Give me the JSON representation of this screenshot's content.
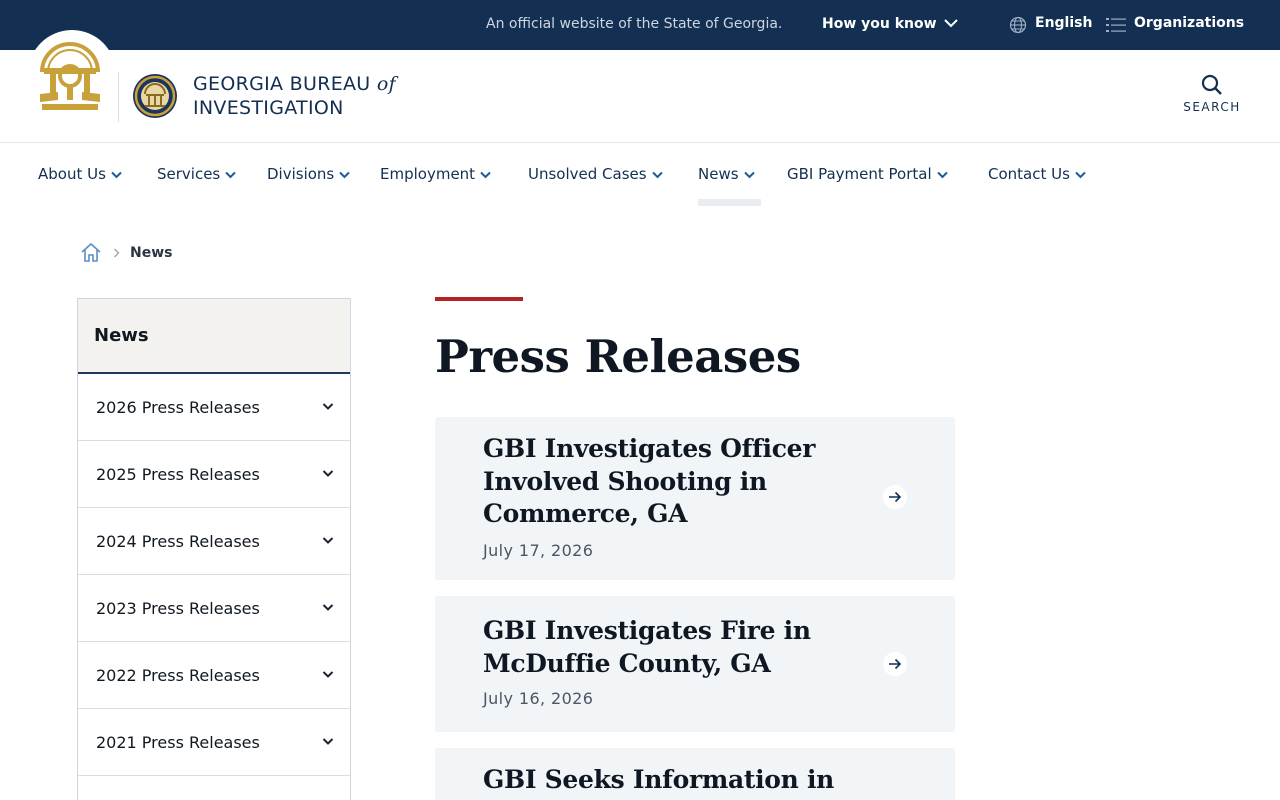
{
  "topbar": {
    "official_text": "An official website of the State of Georgia.",
    "how_you_know": "How you know",
    "language": "English",
    "organizations": "Organizations"
  },
  "header": {
    "org_name_line1": "GEORGIA BUREAU",
    "org_name_of": "of",
    "org_name_line2": "INVESTIGATION",
    "search_label": "SEARCH"
  },
  "nav": {
    "items": [
      {
        "label": "About Us"
      },
      {
        "label": "Services"
      },
      {
        "label": "Divisions"
      },
      {
        "label": "Employment"
      },
      {
        "label": "Unsolved Cases"
      },
      {
        "label": "News",
        "active": true
      },
      {
        "label": "GBI Payment Portal"
      },
      {
        "label": "Contact Us"
      }
    ]
  },
  "breadcrumb": {
    "current": "News"
  },
  "sidebar": {
    "heading": "News",
    "items": [
      {
        "label": "2026 Press Releases"
      },
      {
        "label": "2025 Press Releases"
      },
      {
        "label": "2024 Press Releases"
      },
      {
        "label": "2023 Press Releases"
      },
      {
        "label": "2022 Press Releases"
      },
      {
        "label": "2021 Press Releases"
      }
    ]
  },
  "main": {
    "title": "Press Releases",
    "releases": [
      {
        "title": "GBI Investigates Officer Involved Shooting in Commerce, GA",
        "date": "July 17, 2026"
      },
      {
        "title": "GBI Investigates Fire in McDuffie County, GA",
        "date": "July 16, 2026"
      },
      {
        "title": "GBI Seeks Information in",
        "date": ""
      }
    ]
  },
  "colors": {
    "banner": "#132f51",
    "accent_red": "#b22323",
    "gold": "#c9a13b",
    "card_bg": "#f2f5f8"
  }
}
